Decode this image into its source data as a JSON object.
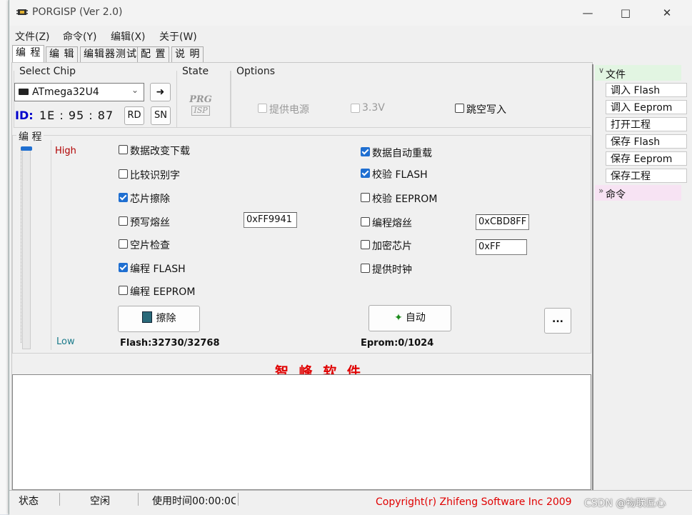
{
  "window": {
    "title": "PORGISP (Ver 2.0)"
  },
  "menu": [
    "文件(Z)",
    "命令(Y)",
    "编辑(X)",
    "关于(W)"
  ],
  "tabs": [
    "编 程",
    "编 辑",
    "编辑器测试",
    "配 置",
    "说 明"
  ],
  "chip": {
    "group_label": "Select Chip",
    "selected": "ATmega32U4",
    "id_label": "ID:",
    "id_value": "1E : 95 : 87",
    "rd_label": "RD",
    "sn_label": "SN"
  },
  "state": {
    "label": "State",
    "badge_top": "PRG",
    "badge_bottom": "ISP"
  },
  "options": {
    "label": "Options",
    "items": [
      {
        "label": "提供电源",
        "checked": false,
        "disabled": true
      },
      {
        "label": "3.3V",
        "checked": false,
        "disabled": true
      },
      {
        "label": "跳空写入",
        "checked": false,
        "disabled": false
      }
    ]
  },
  "program": {
    "group_label": "编 程",
    "slider": {
      "high": "High",
      "low": "Low",
      "level": 1.0
    },
    "left": [
      {
        "label": "数据改变下载",
        "checked": false
      },
      {
        "label": "比较识别字",
        "checked": false
      },
      {
        "label": "芯片擦除",
        "checked": true
      },
      {
        "label": "预写熔丝",
        "checked": false
      },
      {
        "label": "空片检查",
        "checked": false
      },
      {
        "label": "编程 FLASH",
        "checked": true
      },
      {
        "label": "编程 EEPROM",
        "checked": false
      }
    ],
    "right": [
      {
        "label": "数据自动重载",
        "checked": true
      },
      {
        "label": "校验 FLASH",
        "checked": true
      },
      {
        "label": "校验 EEPROM",
        "checked": false
      },
      {
        "label": "编程熔丝",
        "checked": false
      },
      {
        "label": "加密芯片",
        "checked": false
      },
      {
        "label": "提供时钟",
        "checked": false
      }
    ],
    "prewrite_fuse_value": "0xFF9941",
    "fuse_value": "0xCBD8FF",
    "lock_value": "0xFF",
    "erase_button": "擦除",
    "auto_button": "自动",
    "more_button": "...",
    "flash_info": "Flash:32730/32768",
    "eprom_info": "Eprom:0/1024"
  },
  "banner": "智 峰 软 件",
  "sidebar": {
    "file_header": "文件",
    "items": [
      "调入 Flash",
      "调入 Eeprom",
      "打开工程",
      "保存 Flash",
      "保存 Eeprom",
      "保存工程"
    ],
    "command_header": "命令"
  },
  "status": {
    "label": "状态",
    "state": "空闲",
    "time": "使用时间00:00:0C",
    "copyright": "Copyright(r) Zhifeng Software Inc 2009"
  },
  "watermark": "CSDN @物联匠心",
  "colors": {
    "id_blue": "#0000cc",
    "high_red": "#b00000",
    "low_teal": "#1a7a8a",
    "banner_red": "#e00000",
    "sidebar_green": "#e2f5e2",
    "sidebar_pink": "#f7e3f3"
  }
}
